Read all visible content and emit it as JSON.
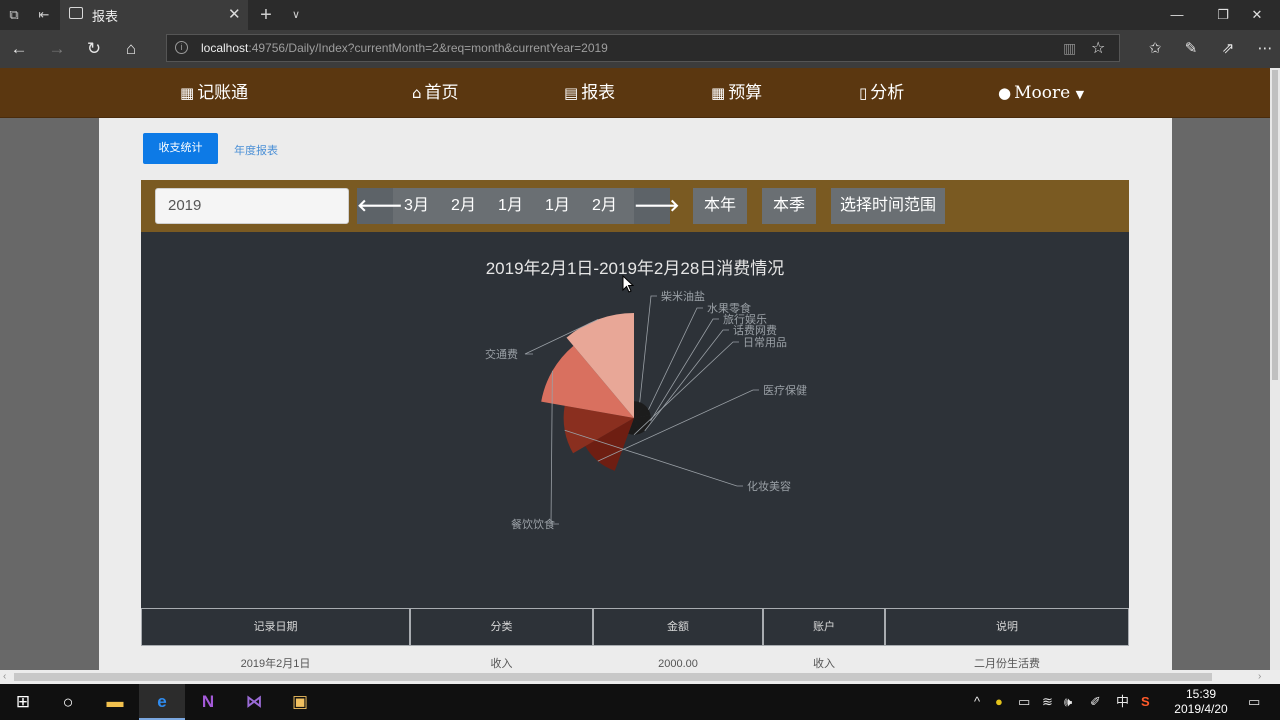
{
  "browser": {
    "tab_title": "报表",
    "url_host": "localhost",
    "url_rest": ":49756/Daily/Index?currentMonth=2&req=month&currentYear=2019"
  },
  "nav": {
    "brand": "记账通",
    "items": [
      "首页",
      "报表",
      "预算",
      "分析"
    ],
    "user": "Moore"
  },
  "tabs": {
    "active": "收支统计",
    "other": "年度报表"
  },
  "toolbar": {
    "year_value": "2019",
    "months": [
      "3月",
      "2月",
      "1月",
      "1月",
      "2月"
    ],
    "buttons": [
      "本年",
      "本季",
      "选择时间范围"
    ]
  },
  "chart_data": {
    "type": "pie",
    "style": "nightingale-rose",
    "title": "2019年2月1日-2019年2月28日消费情况",
    "series": [
      {
        "name": "柴米油盐",
        "value": 1
      },
      {
        "name": "水果零食",
        "value": 1
      },
      {
        "name": "旅行娱乐",
        "value": 1
      },
      {
        "name": "话费网费",
        "value": 1
      },
      {
        "name": "日常用品",
        "value": 1
      },
      {
        "name": "医疗保健",
        "value": 15
      },
      {
        "name": "化妆美容",
        "value": 24
      },
      {
        "name": "餐饮饮食",
        "value": 44
      },
      {
        "name": "交通费",
        "value": 55
      }
    ],
    "colors": [
      "#1c1c1c",
      "#1c1c1c",
      "#1c1c1c",
      "#1c1c1c",
      "#1c1c1c",
      "#6e1e12",
      "#8a2f1f",
      "#d9705f",
      "#e8a797"
    ],
    "label_color": "#9aa0a6"
  },
  "table": {
    "headers": [
      "记录日期",
      "分类",
      "金额",
      "账户",
      "说明"
    ],
    "rows": [
      [
        "2019年2月1日",
        "收入",
        "2000.00",
        "收入",
        "二月份生活费"
      ]
    ]
  },
  "taskbar": {
    "ime": "中",
    "time": "15:39",
    "date": "2019/4/20"
  }
}
